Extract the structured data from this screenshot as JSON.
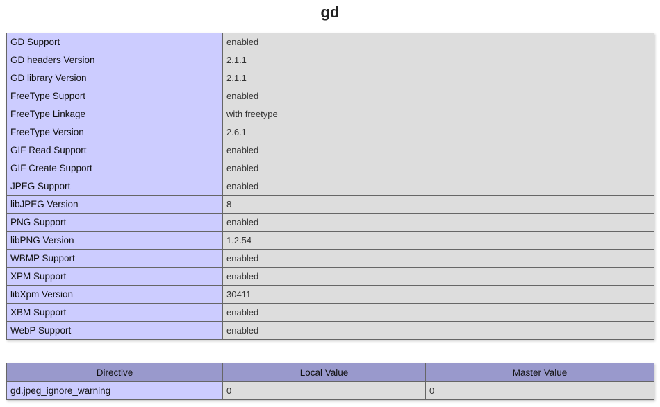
{
  "section": {
    "title": "gd"
  },
  "info_rows": [
    {
      "label": "GD Support",
      "value": "enabled"
    },
    {
      "label": "GD headers Version",
      "value": "2.1.1"
    },
    {
      "label": "GD library Version",
      "value": "2.1.1"
    },
    {
      "label": "FreeType Support",
      "value": "enabled"
    },
    {
      "label": "FreeType Linkage",
      "value": "with freetype"
    },
    {
      "label": "FreeType Version",
      "value": "2.6.1"
    },
    {
      "label": "GIF Read Support",
      "value": "enabled"
    },
    {
      "label": "GIF Create Support",
      "value": "enabled"
    },
    {
      "label": "JPEG Support",
      "value": "enabled"
    },
    {
      "label": "libJPEG Version",
      "value": "8"
    },
    {
      "label": "PNG Support",
      "value": "enabled"
    },
    {
      "label": "libPNG Version",
      "value": "1.2.54"
    },
    {
      "label": "WBMP Support",
      "value": "enabled"
    },
    {
      "label": "XPM Support",
      "value": "enabled"
    },
    {
      "label": "libXpm Version",
      "value": "30411"
    },
    {
      "label": "XBM Support",
      "value": "enabled"
    },
    {
      "label": "WebP Support",
      "value": "enabled"
    }
  ],
  "directives": {
    "headers": {
      "directive": "Directive",
      "local": "Local Value",
      "master": "Master Value"
    },
    "rows": [
      {
        "directive": "gd.jpeg_ignore_warning",
        "local": "0",
        "master": "0"
      }
    ]
  },
  "colors": {
    "label_bg": "#ccccff",
    "value_bg": "#dddddd",
    "header_bg": "#9999cc"
  }
}
